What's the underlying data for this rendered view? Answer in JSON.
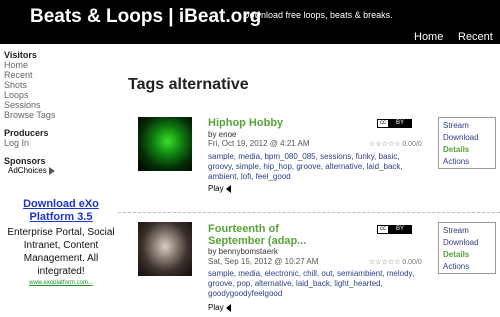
{
  "header": {
    "site_title": "Beats & Loops | iBeat.org",
    "tagline": "Download free loops, beats & breaks.",
    "nav": [
      "Home",
      "Recent"
    ]
  },
  "sidebar": {
    "visitors_heading": "Visitors",
    "visitors_links": [
      "Home",
      "Recent",
      "Shots",
      "Loops",
      "Sessions",
      "Browse Tags"
    ],
    "producers_heading": "Producers",
    "producers_links": [
      "Log In"
    ],
    "sponsors_heading": "Sponsors",
    "adchoices": "AdChoices"
  },
  "ad": {
    "title": "Download eXo Platform 3.5",
    "text": "Enterprise Portal, Social Intranet, Content Management. All integrated!",
    "url": "www.exoplatform.com..."
  },
  "main": {
    "title": "Tags alternative"
  },
  "tracks": [
    {
      "title": "Hiphop Hobby",
      "by": "by enoe",
      "date": "Fri, Oct 19, 2012 @ 4:21 AM",
      "rating": "☆☆☆☆☆ 0.00/0",
      "license_left": "cc",
      "license_right": "BY",
      "tags": "sample, media, bpm_080_085, sessions, funky, basic, groovy, simple, hip_hop, groove, alternative, laid_back, ambient, lofi, feel_good",
      "play": "Play",
      "actions": [
        "Stream",
        "Download",
        "Details",
        "Actions"
      ]
    },
    {
      "title": "Fourteenth of September (adap...",
      "by": "by bennybomstaerk",
      "date": "Sat, Sep 15, 2012 @ 10:27 AM",
      "rating": "☆☆☆☆☆ 0.00/0",
      "license_left": "cc",
      "license_right": "BY",
      "tags": "sample, media, electronic, chill, out, semiambient, melody, groove, pop, alternative, laid_back, light_hearted, goodygoodyfeelgood",
      "play": "Play",
      "actions": [
        "Stream",
        "Download",
        "Details",
        "Actions"
      ]
    }
  ]
}
